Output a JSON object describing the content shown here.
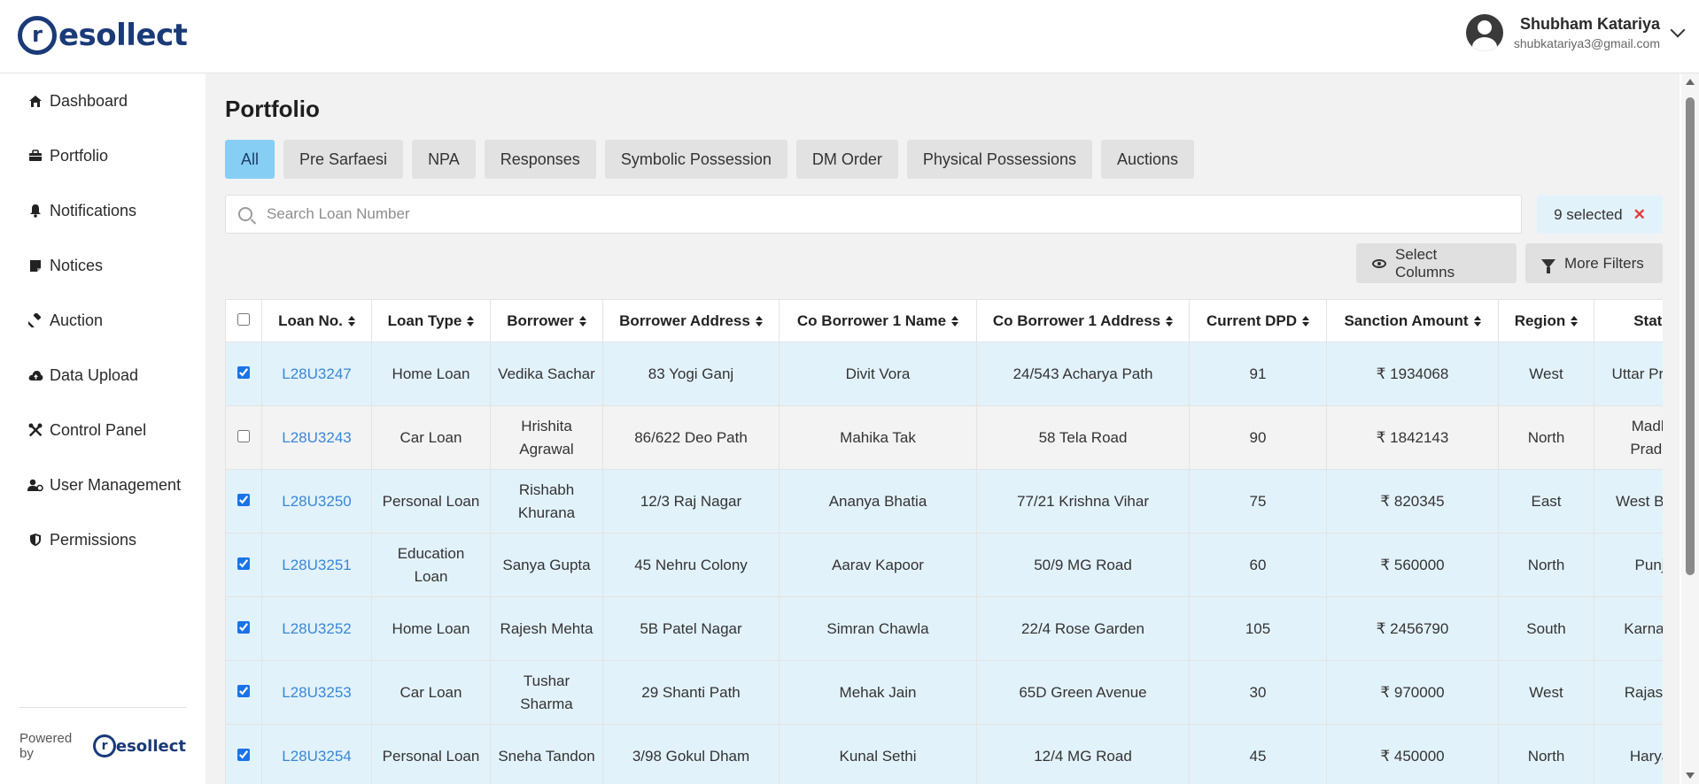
{
  "brand": {
    "logo_letter": "r",
    "logo_text": "esollect"
  },
  "user": {
    "name": "Shubham Katariya",
    "email": "shubkatariya3@gmail.com"
  },
  "sidebar": {
    "items": [
      {
        "label": "Dashboard",
        "icon": "home-icon"
      },
      {
        "label": "Portfolio",
        "icon": "briefcase-icon"
      },
      {
        "label": "Notifications",
        "icon": "bell-icon"
      },
      {
        "label": "Notices",
        "icon": "note-icon"
      },
      {
        "label": "Auction",
        "icon": "gavel-icon"
      },
      {
        "label": "Data Upload",
        "icon": "cloud-upload-icon"
      },
      {
        "label": "Control Panel",
        "icon": "tools-icon"
      },
      {
        "label": "User Management",
        "icon": "user-gear-icon"
      },
      {
        "label": "Permissions",
        "icon": "shield-icon"
      }
    ],
    "footer": {
      "powered_by": "Powered by",
      "logo_letter": "r",
      "logo_text": "esollect"
    }
  },
  "main": {
    "title": "Portfolio",
    "tabs": [
      "All",
      "Pre Sarfaesi",
      "NPA",
      "Responses",
      "Symbolic Possession",
      "DM Order",
      "Physical Possessions",
      "Auctions"
    ],
    "active_tab": "All",
    "search": {
      "placeholder": "Search Loan Number",
      "value": ""
    },
    "selected": {
      "label": "9 selected",
      "clear": "✕"
    },
    "buttons": {
      "select_columns": "Select Columns",
      "more_filters": "More Filters"
    }
  },
  "table": {
    "columns": [
      "Loan No.",
      "Loan Type",
      "Borrower",
      "Borrower Address",
      "Co Borrower 1 Name",
      "Co Borrower 1 Address",
      "Current DPD",
      "Sanction Amount",
      "Region",
      "State"
    ],
    "rows": [
      {
        "checked": true,
        "cells": [
          "L28U3247",
          "Home Loan",
          "Vedika Sachar",
          "83 Yogi Ganj",
          "Divit Vora",
          "24/543 Acharya Path",
          "91",
          "₹ 1934068",
          "West",
          "Uttar Pradesh"
        ]
      },
      {
        "checked": false,
        "cells": [
          "L28U3243",
          "Car Loan",
          "Hrishita Agrawal",
          "86/622 Deo Path",
          "Mahika Tak",
          "58 Tela Road",
          "90",
          "₹ 1842143",
          "North",
          "Madhya Pradesh"
        ]
      },
      {
        "checked": true,
        "cells": [
          "L28U3250",
          "Personal Loan",
          "Rishabh Khurana",
          "12/3 Raj Nagar",
          "Ananya Bhatia",
          "77/21 Krishna Vihar",
          "75",
          "₹ 820345",
          "East",
          "West Bengal"
        ]
      },
      {
        "checked": true,
        "cells": [
          "L28U3251",
          "Education Loan",
          "Sanya Gupta",
          "45 Nehru Colony",
          "Aarav Kapoor",
          "50/9 MG Road",
          "60",
          "₹ 560000",
          "North",
          "Punjab"
        ]
      },
      {
        "checked": true,
        "cells": [
          "L28U3252",
          "Home Loan",
          "Rajesh Mehta",
          "5B Patel Nagar",
          "Simran Chawla",
          "22/4 Rose Garden",
          "105",
          "₹ 2456790",
          "South",
          "Karnataka"
        ]
      },
      {
        "checked": true,
        "cells": [
          "L28U3253",
          "Car Loan",
          "Tushar Sharma",
          "29 Shanti Path",
          "Mehak Jain",
          "65D Green Avenue",
          "30",
          "₹ 970000",
          "West",
          "Rajasthan"
        ]
      },
      {
        "checked": true,
        "cells": [
          "L28U3254",
          "Personal Loan",
          "Sneha Tandon",
          "3/98 Gokul Dham",
          "Kunal Sethi",
          "12/4 MG Road",
          "45",
          "₹ 450000",
          "North",
          "Haryana"
        ]
      }
    ]
  }
}
